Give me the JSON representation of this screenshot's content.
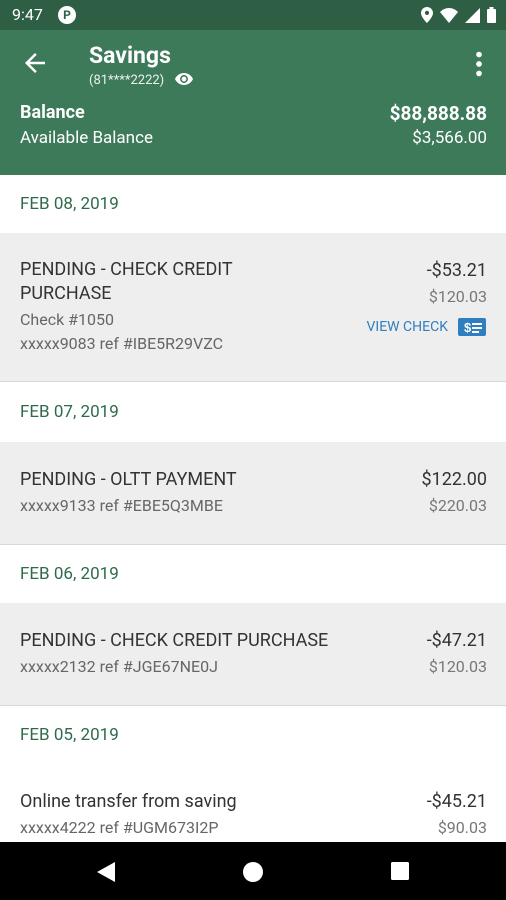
{
  "status": {
    "time": "9:47",
    "app_badge": "P"
  },
  "header": {
    "title": "Savings",
    "account_number": "(81****2222)",
    "balance_label": "Balance",
    "balance_value": "$88,888.88",
    "available_label": "Available Balance",
    "available_value": "$3,566.00"
  },
  "groups": [
    {
      "date": "FEB 08, 2019",
      "transactions": [
        {
          "desc_line1": "PENDING - CHECK CREDIT",
          "desc_line2": "PURCHASE",
          "check": "Check #1050",
          "ref": "xxxxx9083 ref #IBE5R29VZC",
          "amount": "-$53.21",
          "balance": "$120.03",
          "action": "VIEW CHECK"
        }
      ]
    },
    {
      "date": "FEB 07, 2019",
      "transactions": [
        {
          "desc": "PENDING - OLTT PAYMENT",
          "ref": "xxxxx9133 ref #EBE5Q3MBE",
          "amount": "$122.00",
          "balance": "$220.03"
        }
      ]
    },
    {
      "date": "FEB 06, 2019",
      "transactions": [
        {
          "desc": "PENDING - CHECK CREDIT PURCHASE",
          "ref": "xxxxx2132 ref #JGE67NE0J",
          "amount": "-$47.21",
          "balance": "$120.03"
        }
      ]
    },
    {
      "date": "FEB 05, 2019",
      "transactions": [
        {
          "desc": "Online transfer from saving",
          "ref": "xxxxx4222 ref #UGM673I2P",
          "amount": "-$45.21",
          "balance": "$90.03"
        }
      ]
    }
  ],
  "colors": {
    "header": "#3d7a5a",
    "statusbar": "#2e5f45",
    "date_text": "#2e6b4b",
    "link": "#2f7fc0"
  },
  "icons": [
    "back-arrow-icon",
    "eye-icon",
    "more-vert-icon",
    "check-icon",
    "nav-back-icon",
    "nav-home-icon",
    "nav-recents-icon"
  ]
}
